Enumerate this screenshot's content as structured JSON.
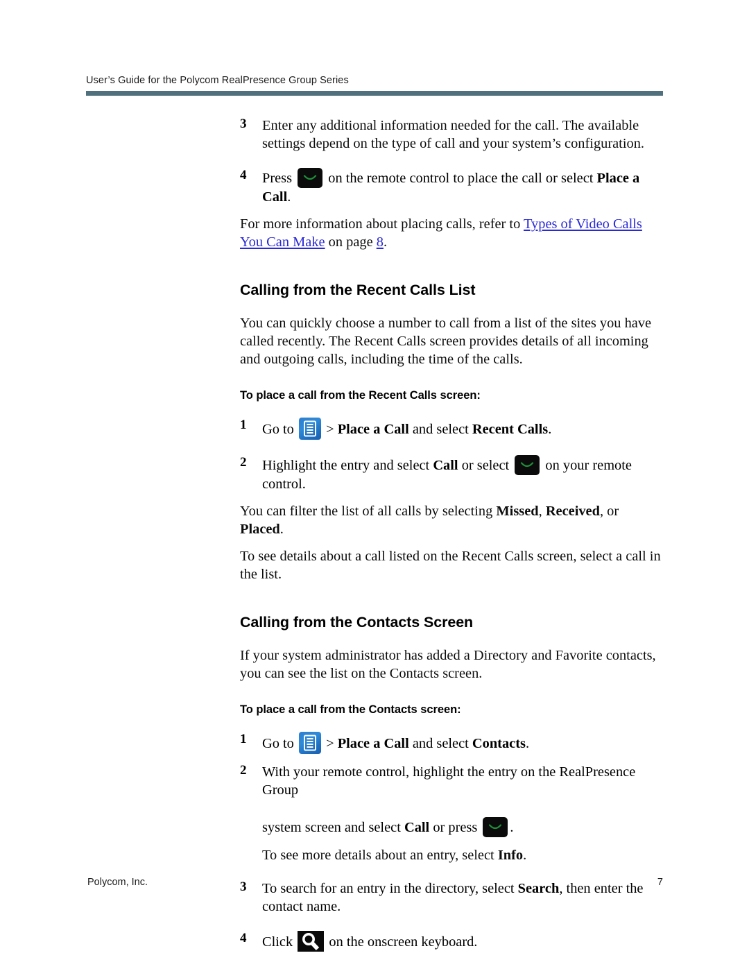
{
  "header": {
    "running_head": "User’s Guide for the Polycom RealPresence Group Series",
    "rule_color": "#50707d"
  },
  "colors": {
    "link": "#2a29d6",
    "heading": "#000000",
    "call_icon_bg": "#0b0b0b",
    "call_icon_arc": "#1f8f3a",
    "home_icon_bg": "#2680cf",
    "search_icon_bg": "#0a0a0a"
  },
  "icons": {
    "call_button": "call-button-icon",
    "home_menu": "home-menu-icon",
    "search": "search-icon"
  },
  "body": {
    "step3": {
      "num": "3",
      "text": "Enter any additional information needed for the call. The available settings depend on the type of call and your system’s configuration."
    },
    "step4": {
      "num": "4",
      "before_icon": "Press ",
      "after_icon": " on the remote control to place the call or select ",
      "bold_tail": "Place a Call",
      "period": "."
    },
    "more_info": {
      "lead": "For more information about placing calls, refer to ",
      "link_text": "Types of Video Calls You Can Make",
      "mid": " on page ",
      "page_link": "8",
      "end": "."
    }
  },
  "recent_calls": {
    "heading": "Calling from the Recent Calls List",
    "intro": "You can quickly choose a number to call from a list of the sites you have called recently. The Recent Calls screen provides details of all incoming and outgoing calls, including the time of the calls.",
    "subheading": "To place a call from the Recent Calls screen:",
    "step1": {
      "num": "1",
      "before_icon": "Go to ",
      "after_icon": " > ",
      "bold_a": "Place a Call",
      "mid": " and select ",
      "bold_b": "Recent Calls",
      "end": "."
    },
    "step2": {
      "num": "2",
      "before": "Highlight the entry and select ",
      "bold_a": "Call",
      "mid": " or select ",
      "after_icon": " on your remote control."
    },
    "filter_note_a": "You can filter the list of all calls by selecting ",
    "filter_bold_1": "Missed",
    "filter_sep_1": ", ",
    "filter_bold_2": "Received",
    "filter_sep_2": ", or ",
    "filter_bold_3": "Placed",
    "filter_end": ".",
    "details_note": "To see details about a call listed on the Recent Calls screen, select a call in the list."
  },
  "contacts": {
    "heading": "Calling from the Contacts Screen",
    "intro": "If your system administrator has added a Directory and Favorite contacts, you can see the list on the Contacts screen.",
    "subheading": "To place a call from the Contacts screen:",
    "step1": {
      "num": "1",
      "before_icon": "Go to ",
      "after_icon": " > ",
      "bold_a": "Place a Call",
      "mid": " and select ",
      "bold_b": "Contacts",
      "end": "."
    },
    "step2": {
      "num": "2",
      "line1": "With your remote control, highlight the entry on the RealPresence Group",
      "line2_before": "system screen and select ",
      "bold_a": "Call",
      "line2_mid": " or press ",
      "line2_end": "."
    },
    "info_note_a": "To see more details about an entry, select ",
    "info_bold": "Info",
    "info_note_b": ".",
    "step3": {
      "num": "3",
      "before": "To search for an entry in the directory, select ",
      "bold_a": "Search",
      "after": ", then enter the contact name."
    },
    "step4": {
      "num": "4",
      "before_icon": "Click ",
      "after_icon": " on the onscreen keyboard."
    }
  },
  "footer": {
    "company": "Polycom, Inc.",
    "page_number": "7"
  }
}
